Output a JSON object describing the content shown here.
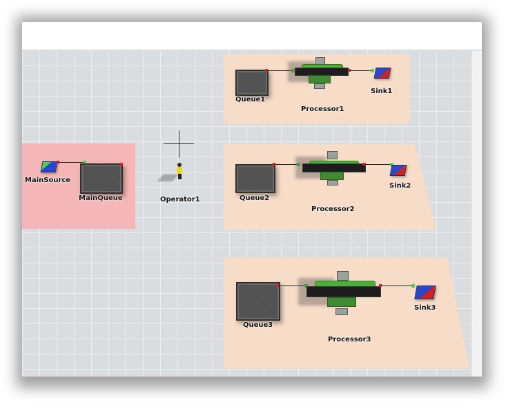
{
  "window": {
    "title_fragment": ""
  },
  "objects": {
    "main_source": "MainSource",
    "main_queue": "MainQueue",
    "operator": "Operator1",
    "queue1": "Queue1",
    "processor1": "Processor1",
    "sink1": "Sink1",
    "queue2": "Queue2",
    "processor2": "Processor2",
    "sink2": "Sink2",
    "queue3": "Queue3",
    "processor3": "Processor3",
    "sink3": "Sink3"
  },
  "colors": {
    "grid_background": "#d9dde0",
    "processor_zone": "#f7dcc8",
    "source_zone": "#f4b6b6",
    "processor_green": "#4caf3a",
    "sink_blue": "#2b46c8",
    "port_red": "#e02020",
    "port_green": "#4fd04f"
  }
}
